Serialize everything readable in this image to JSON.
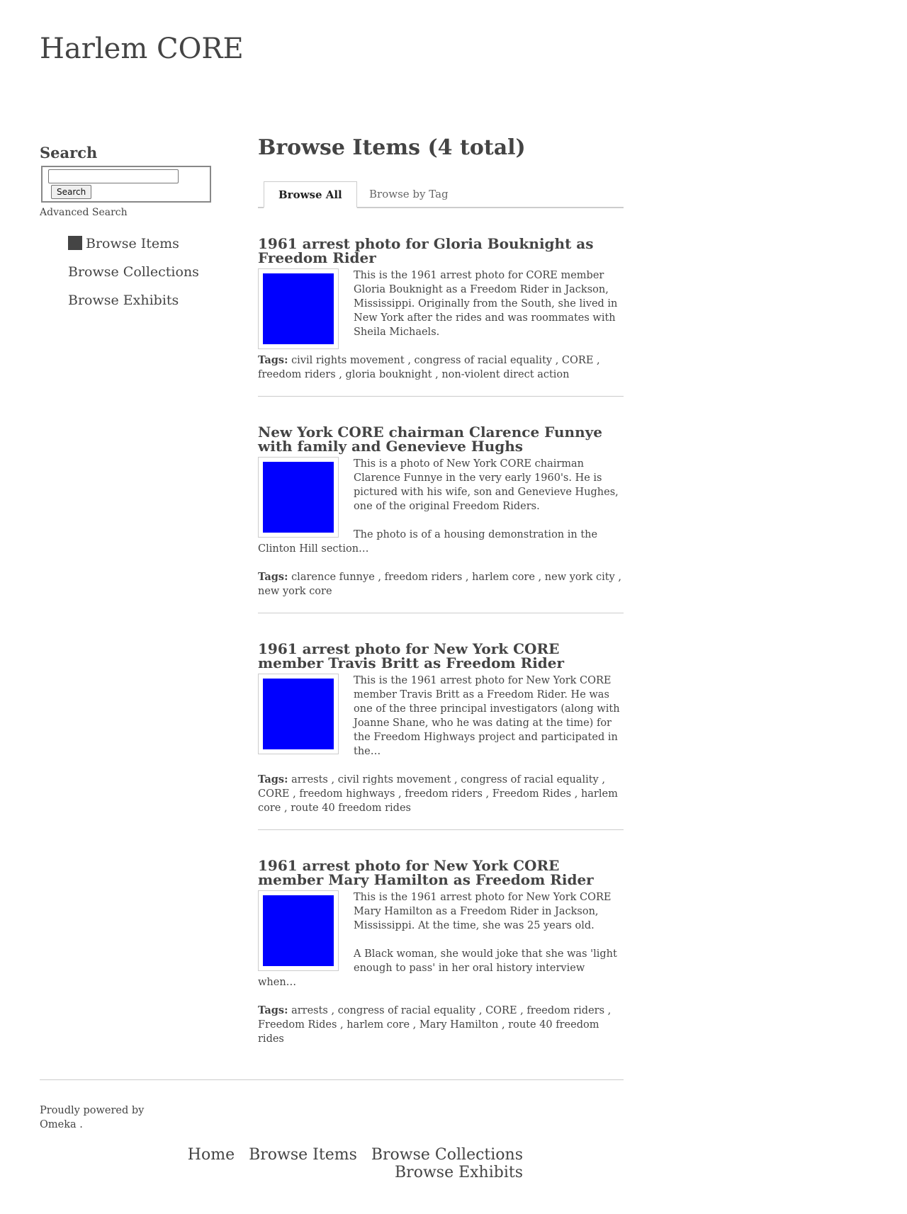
{
  "site": {
    "title": "Harlem CORE"
  },
  "sidebar": {
    "search_heading": "Search",
    "search_value": "",
    "search_button": "Search",
    "advanced_search": "Advanced Search",
    "nav": [
      {
        "label": "Browse Items",
        "current": true
      },
      {
        "label": "Browse Collections",
        "current": false
      },
      {
        "label": "Browse Exhibits",
        "current": false
      }
    ]
  },
  "main": {
    "title": "Browse Items (4 total)",
    "tabs": [
      {
        "label": "Browse All",
        "active": true
      },
      {
        "label": "Browse by Tag",
        "active": false
      }
    ],
    "tags_label": "Tags:",
    "items": [
      {
        "title": "1961 arrest photo for Gloria Bouknight as Freedom Rider",
        "thumbnail_color": "#0000ff",
        "description": [
          "This is the 1961 arrest photo for CORE member Gloria Bouknight as a Freedom Rider in Jackson, Mississippi. Originally from the South, she lived in New York after the rides and was roommates with Sheila Michaels."
        ],
        "tags": [
          "civil rights movement",
          "congress of racial equality",
          "CORE",
          "freedom riders",
          "gloria bouknight",
          "non-violent direct action"
        ]
      },
      {
        "title": "New York CORE chairman Clarence Funnye with family and Genevieve Hughs",
        "thumbnail_color": "#0000ff",
        "description": [
          "This is a photo of New York CORE chairman Clarence Funnye in the very early 1960's. He is pictured with his wife, son and Genevieve Hughes, one of the original Freedom Riders.",
          "The photo is of a housing demonstration in the Clinton Hill section…"
        ],
        "tags": [
          "clarence funnye",
          "freedom riders",
          "harlem core",
          "new york city",
          "new york core"
        ]
      },
      {
        "title": "1961 arrest photo for New York CORE member Travis Britt as Freedom Rider",
        "thumbnail_color": "#0000ff",
        "description": [
          "This is the 1961 arrest photo for New York CORE member Travis Britt as a Freedom Rider. He was one of the three principal investigators (along with Joanne Shane, who he was dating at the time) for the Freedom Highways project and participated in the…"
        ],
        "tags": [
          "arrests",
          "civil rights movement",
          "congress of racial equality",
          "CORE",
          "freedom highways",
          "freedom riders",
          "Freedom Rides",
          "harlem core",
          "route 40 freedom rides"
        ]
      },
      {
        "title": "1961 arrest photo for New York CORE member Mary Hamilton as Freedom Rider",
        "thumbnail_color": "#0000ff",
        "description": [
          "This is the 1961 arrest photo for New York CORE Mary Hamilton as a Freedom Rider in Jackson, Mississippi. At the time, she was 25 years old.",
          "A Black woman, she would joke that she was 'light enough to pass' in her oral history interview when…"
        ],
        "tags": [
          "arrests",
          "congress of racial equality",
          "CORE",
          "freedom riders",
          "Freedom Rides",
          "harlem core",
          "Mary Hamilton",
          "route 40 freedom rides"
        ]
      }
    ]
  },
  "footer": {
    "powered_prefix": "Proudly powered by",
    "powered_link": "Omeka",
    "powered_suffix": ".",
    "nav": [
      "Home",
      "Browse Items",
      "Browse Collections",
      "Browse Exhibits"
    ]
  }
}
